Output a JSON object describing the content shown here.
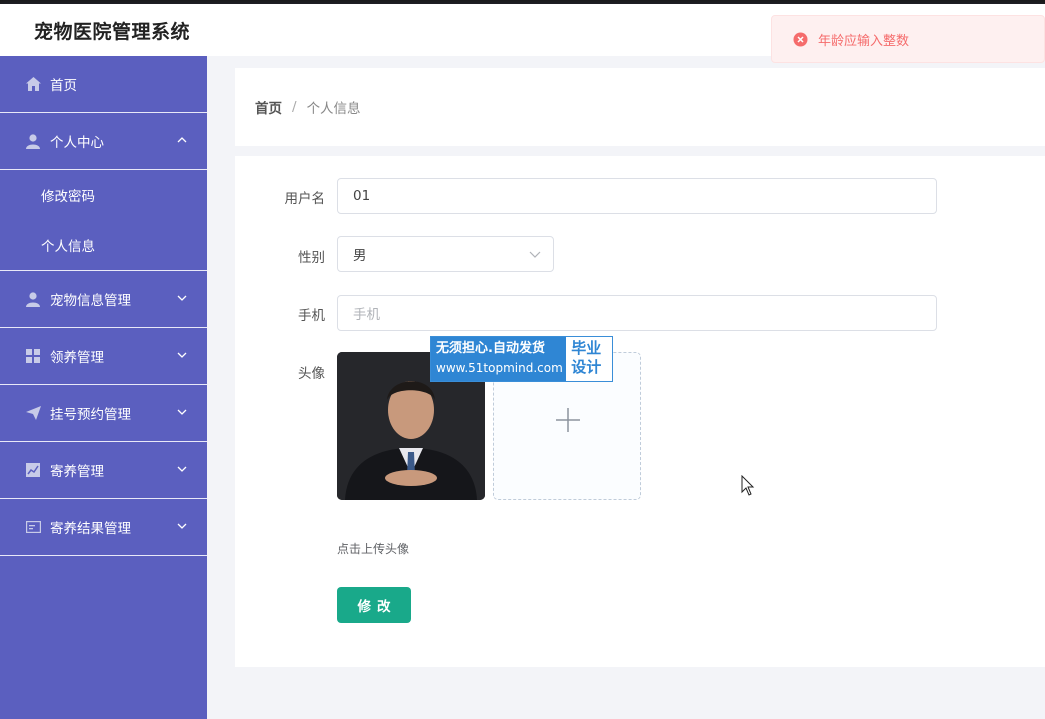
{
  "app": {
    "title": "宠物医院管理系统"
  },
  "sidebar": {
    "items": [
      {
        "label": "首页",
        "icon": "home-icon"
      },
      {
        "label": "个人中心",
        "icon": "user-icon",
        "expanded": true,
        "children": [
          "修改密码",
          "个人信息"
        ]
      },
      {
        "label": "宠物信息管理",
        "icon": "user-icon"
      },
      {
        "label": "领养管理",
        "icon": "grid-icon"
      },
      {
        "label": "挂号预约管理",
        "icon": "send-icon"
      },
      {
        "label": "寄养管理",
        "icon": "chart-icon"
      },
      {
        "label": "寄养结果管理",
        "icon": "card-icon"
      }
    ]
  },
  "breadcrumb": {
    "home": "首页",
    "separator": "/",
    "current": "个人信息"
  },
  "form": {
    "username_label": "用户名",
    "username_value": "01",
    "gender_label": "性别",
    "gender_value": "男",
    "phone_label": "手机",
    "phone_placeholder": "手机",
    "avatar_label": "头像",
    "upload_hint": "点击上传头像",
    "submit_label": "修改"
  },
  "watermark": {
    "line1": "无须担心.自动发货",
    "line2": "www.51topmind.com",
    "badge": "毕业设计"
  },
  "toast": {
    "message": "年龄应输入整数",
    "type": "error"
  },
  "colors": {
    "sidebar": "#5b5fbf",
    "primary_button": "#19a98a",
    "error": "#f56c6c"
  }
}
